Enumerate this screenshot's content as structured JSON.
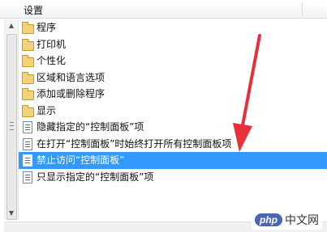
{
  "header": {
    "title": "设置"
  },
  "items": [
    {
      "type": "folder",
      "label": "程序"
    },
    {
      "type": "folder",
      "label": "打印机"
    },
    {
      "type": "folder",
      "label": "个性化"
    },
    {
      "type": "folder",
      "label": "区域和语言选项"
    },
    {
      "type": "folder",
      "label": "添加或删除程序"
    },
    {
      "type": "folder",
      "label": "显示"
    },
    {
      "type": "setting",
      "label": "隐藏指定的“控制面板”项"
    },
    {
      "type": "setting",
      "label": "在打开“控制面板”时始终打开所有控制面板项"
    },
    {
      "type": "setting",
      "label": "禁止访问“控制面板”",
      "selected": true
    },
    {
      "type": "setting",
      "label": "只显示指定的“控制面板”项"
    }
  ],
  "watermark": {
    "brand": "php",
    "text": "中文网"
  },
  "colors": {
    "selection": "#3399ff",
    "annotation_arrow": "#e8303a"
  }
}
